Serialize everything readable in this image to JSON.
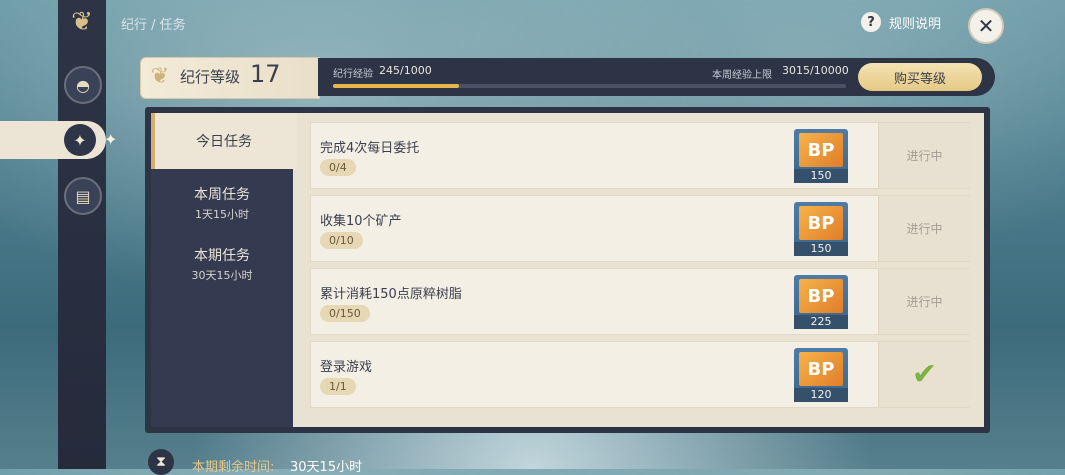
{
  "breadcrumb": "纪行 / 任务",
  "header": {
    "rules_label": "规则说明",
    "help_icon": "?",
    "close_icon": "✕"
  },
  "rail": {
    "icons": [
      "emblem-icon",
      "shell-icon",
      "banner-icon",
      "scroll-icon"
    ],
    "active_index": 2
  },
  "level": {
    "label": "纪行等级",
    "value": "17"
  },
  "exp": {
    "label": "纪行经验",
    "value": "245/1000",
    "progress": 0.245
  },
  "weekly": {
    "label": "本周经验上限",
    "value": "3015/10000"
  },
  "buy_button": "购买等级",
  "tabs": [
    {
      "title": "今日任务",
      "sub": ""
    },
    {
      "title": "本周任务",
      "sub": "1天15小时"
    },
    {
      "title": "本期任务",
      "sub": "30天15小时"
    }
  ],
  "tasks": [
    {
      "title": "完成4次每日委托",
      "progress": "0/4",
      "reward_icon": "BP",
      "reward_qty": "150",
      "status": "进行中"
    },
    {
      "title": "收集10个矿产",
      "progress": "0/10",
      "reward_icon": "BP",
      "reward_qty": "150",
      "status": "进行中"
    },
    {
      "title": "累计消耗150点原粹树脂",
      "progress": "0/150",
      "reward_icon": "BP",
      "reward_qty": "225",
      "status": "进行中"
    },
    {
      "title": "登录游戏",
      "progress": "1/1",
      "reward_icon": "BP",
      "reward_qty": "120",
      "status": "✔"
    }
  ],
  "footer": {
    "label": "本期剩余时间:",
    "value": "30天15小时"
  }
}
